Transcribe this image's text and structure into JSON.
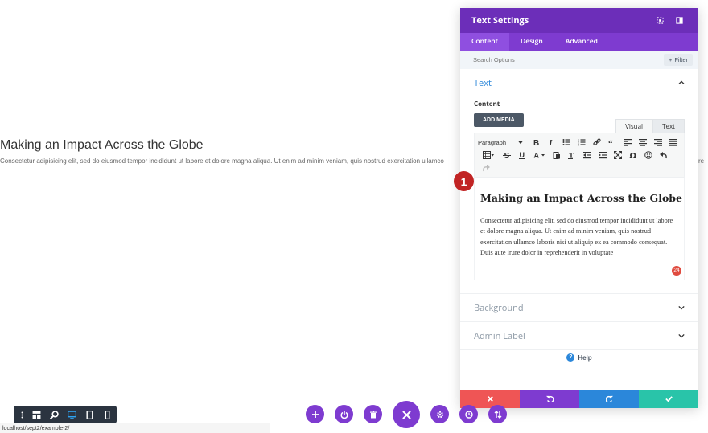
{
  "page": {
    "heading": "Making an Impact Across the Globe",
    "paragraph": "Consectetur adipisicing elit, sed do eiusmod tempor incididunt ut labore et dolore magna aliqua. Ut enim ad minim veniam, quis nostrud exercitation ullamco",
    "paragraph_tail": "re"
  },
  "status_bar": {
    "url": "localhost/sept2/example-2/"
  },
  "view_toolbar": {
    "icons": [
      "more-vertical-icon",
      "wireframe-icon",
      "zoom-icon",
      "desktop-icon",
      "tablet-icon",
      "phone-icon"
    ]
  },
  "bottom_actions": {
    "icons": [
      "plus-icon",
      "power-icon",
      "trash-icon",
      "close-icon",
      "gear-icon",
      "history-icon",
      "sort-icon"
    ]
  },
  "panel": {
    "title": "Text Settings",
    "tabs": [
      "Content",
      "Design",
      "Advanced"
    ],
    "active_tab": "Content",
    "search_placeholder": "Search Options",
    "filter_label": "Filter",
    "filter_prefix": "+",
    "section_text": "Text",
    "content_label": "Content",
    "add_media": "ADD MEDIA",
    "mode_tabs": [
      "Visual",
      "Text"
    ],
    "format_select": "Paragraph",
    "editor": {
      "heading": "Making an Impact Across the Globe",
      "body": "Consectetur adipisicing elit, sed do eiusmod tempor incididunt ut labore et dolore magna aliqua. Ut enim ad minim veniam, quis nostrud exercitation ullamco laboris nisi ut aliquip ex ea commodo consequat. Duis aute irure dolor in reprehenderit in voluptate",
      "grammar_count": "24"
    },
    "step_badge": "1",
    "section_background": "Background",
    "section_admin": "Admin Label",
    "help": "Help",
    "footer_colors": [
      "#ef5555",
      "#7e3bd0",
      "#2b87da",
      "#29c4a9"
    ]
  },
  "colors": {
    "panel_header": "#6c2eb9",
    "accent_purple": "#7e3bd0",
    "accent_blue": "#2b87da",
    "step_red": "#c12424"
  }
}
